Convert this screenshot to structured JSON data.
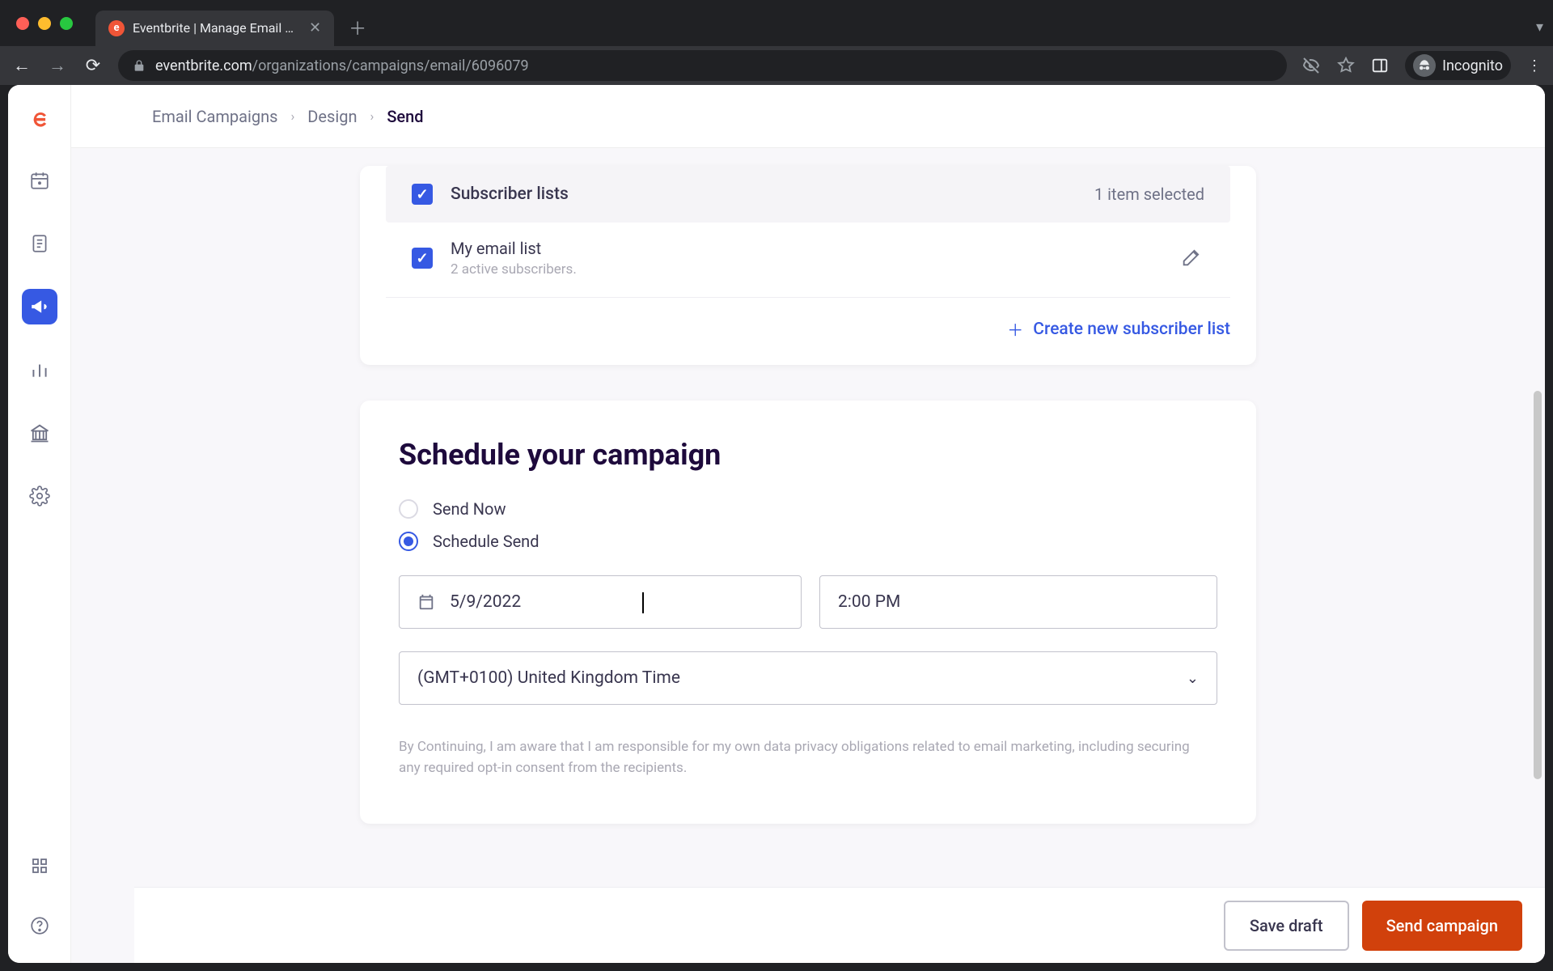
{
  "browser": {
    "tab_title": "Eventbrite | Manage Email Cam",
    "url_host": "eventbrite.com",
    "url_path": "/organizations/campaigns/email/6096079",
    "incognito_label": "Incognito"
  },
  "breadcrumbs": {
    "a": "Email Campaigns",
    "b": "Design",
    "c": "Send"
  },
  "subscriber": {
    "header": "Subscriber lists",
    "selected": "1 item selected",
    "list_name": "My email list",
    "list_detail": "2 active subscribers.",
    "create_label": "Create new subscriber list"
  },
  "schedule": {
    "title": "Schedule your campaign",
    "option_now": "Send Now",
    "option_later": "Schedule Send",
    "date_value": "5/9/2022",
    "time_value": "2:00 PM",
    "timezone": "(GMT+0100) United Kingdom Time",
    "disclaimer": "By Continuing, I am aware that I am responsible for my own data privacy obligations related to email marketing, including securing any required opt-in consent from the recipients."
  },
  "footer": {
    "save": "Save draft",
    "send": "Send campaign"
  }
}
